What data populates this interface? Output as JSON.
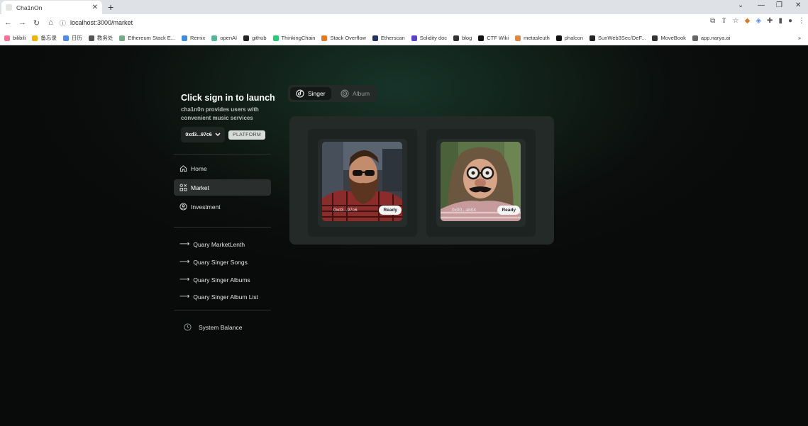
{
  "browser": {
    "tab_title": "Cha1nOn",
    "url": "localhost:3000/market",
    "bookmarks": [
      "bilibili",
      "备忘录",
      "日历",
      "教务处",
      "Ethereum Stack E...",
      "Remix",
      "openAI",
      "github",
      "ThinkingChain",
      "Stack Overflow",
      "Etherscan",
      "Solidity doc",
      "blog",
      "CTF Wiki",
      "metasleuth",
      "phalcon",
      "SunWeb3Sec/DeF...",
      "MoveBook",
      "app.narya.ai"
    ]
  },
  "sidebar": {
    "title": "Click sign in to launch",
    "subtitle": "cha1n0n provides users with convenient music services",
    "account": "0xd3...97c6",
    "platform_badge": "PLATFORM",
    "nav": [
      {
        "label": "Home",
        "icon": "home-icon"
      },
      {
        "label": "Market",
        "icon": "market-icon",
        "active": true
      },
      {
        "label": "Investment",
        "icon": "investment-icon"
      }
    ],
    "queries": [
      "Quary MarketLenth",
      "Quary Singer Songs",
      "Quary Singer Albums",
      "Quary Singer Album List"
    ],
    "balance_label": "System Balance"
  },
  "tabs": {
    "singer": "Singer",
    "album": "Album",
    "active": "Singer"
  },
  "market": {
    "cards": [
      {
        "address": "0xd3...97c6",
        "status": "Ready"
      },
      {
        "address": "0x00...ab04",
        "status": "Ready"
      }
    ]
  }
}
